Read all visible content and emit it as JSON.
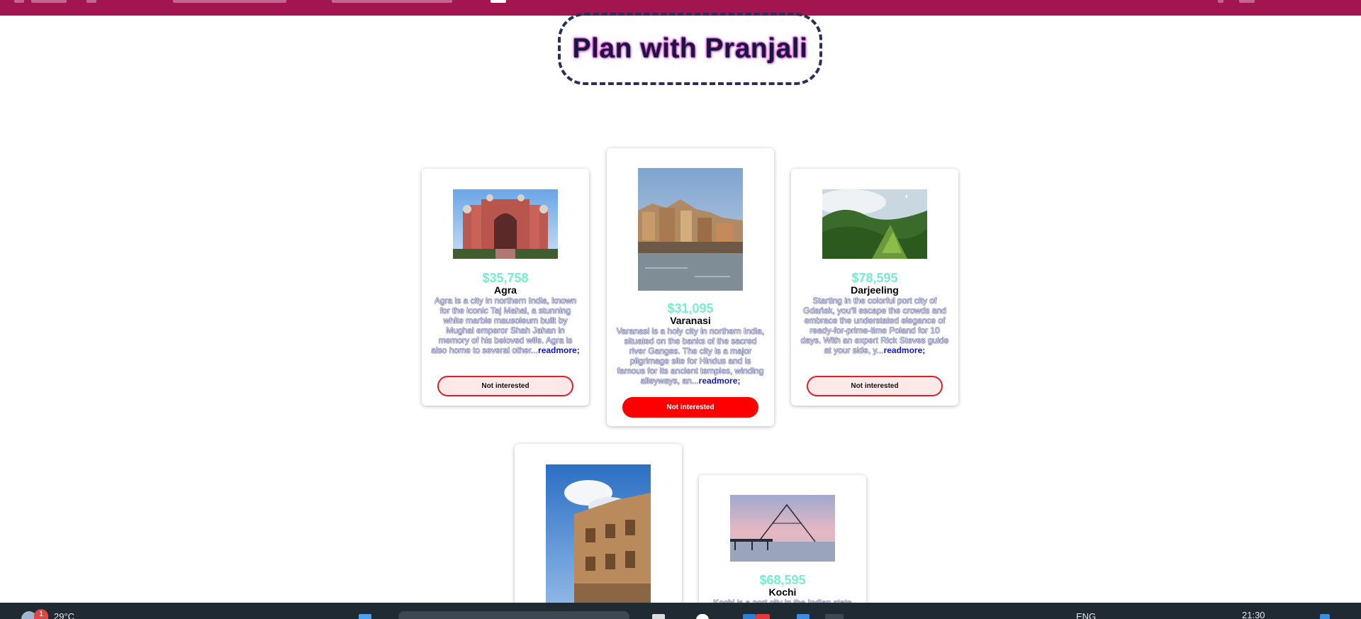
{
  "header": {
    "title": "Plan with Pranjali"
  },
  "cards": [
    {
      "price": "$35,758",
      "city": "Agra",
      "description": "Agra is a city in northern India, known for the iconic Taj Mahal, a stunning white marble mausoleum built by Mughal emperor Shah Jahan in memory of his beloved wife. Agra is also home to several other...",
      "read_more": "readmore;",
      "button": "Not interested"
    },
    {
      "price": "$31,095",
      "city": "Varanasi",
      "description": "Varanasi is a holy city in northern India, situated on the banks of the sacred river Ganges. The city is a major pilgrimage site for Hindus and is famous for its ancient temples, winding alleyways, an...",
      "read_more": "readmore;",
      "button": "Not interested"
    },
    {
      "price": "$78,595",
      "city": "Darjeeling",
      "description": "Starting in the colorful port city of Gdańsk, you'll escape the crowds and embrace the understated elegance of ready-for-prime-time Poland for 10 days. With an expert Rick Steves guide at your side, y...",
      "read_more": "readmore;",
      "button": "Not interested"
    },
    {},
    {
      "price": "$68,595",
      "city": "Kochi",
      "description": "Kochi is a port city in the Indian state"
    }
  ],
  "taskbar": {
    "weather": "29°C",
    "weather_badge": "1",
    "language": "ENG",
    "time": "21:30"
  },
  "colors": {
    "topbar": "#a3154e",
    "price": "#73f0cc",
    "button_red": "#ff0000",
    "readmore": "#0f17c9"
  }
}
